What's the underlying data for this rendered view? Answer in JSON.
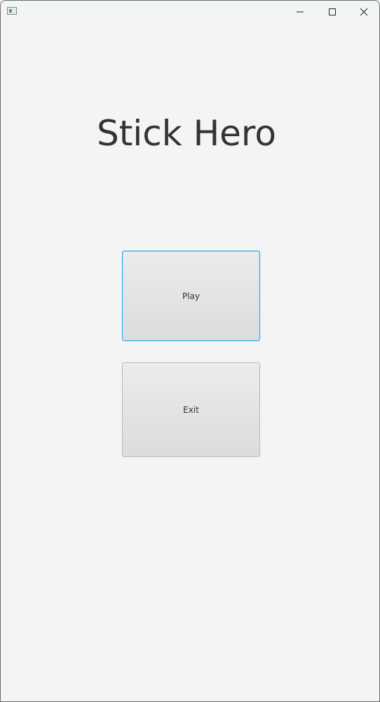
{
  "window": {
    "controls": {
      "minimize_icon": "minimize-icon",
      "maximize_icon": "maximize-icon",
      "close_icon": "close-icon"
    }
  },
  "main": {
    "title": "Stick Hero",
    "play_label": "Play",
    "exit_label": "Exit"
  },
  "colors": {
    "background": "#f4f4f4",
    "focus_border": "#2aa1e0",
    "button_top": "#ececec",
    "button_bottom": "#dcdcdc",
    "text": "#333333"
  }
}
